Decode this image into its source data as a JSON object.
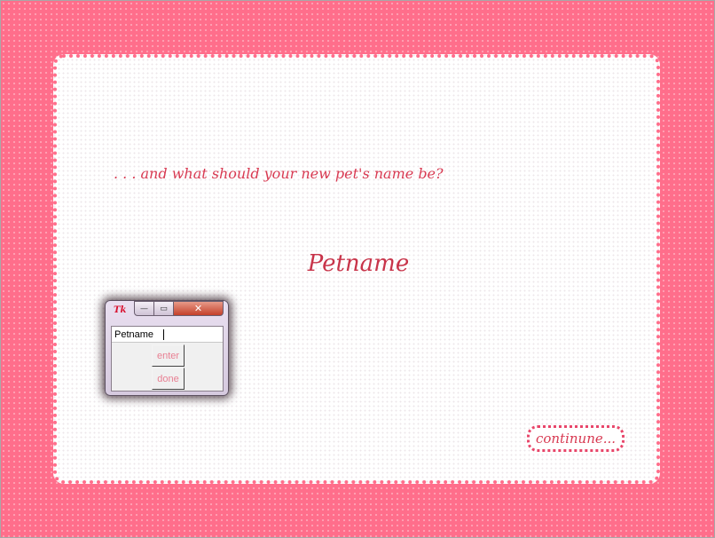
{
  "prompt": ". . . and what should your new pet's name be?",
  "pet_name_display": "Petname",
  "continue_label": "continune...",
  "tk_window": {
    "logo": "Tk",
    "minimize_symbol": "—",
    "maximize_symbol": "▭",
    "close_symbol": "✕",
    "input_value": "Petname",
    "enter_label": "enter",
    "done_label": "done"
  },
  "colors": {
    "background_pink": "#ff6e8b",
    "text_red": "#d83a52",
    "button_text_pink": "#e87f92"
  }
}
